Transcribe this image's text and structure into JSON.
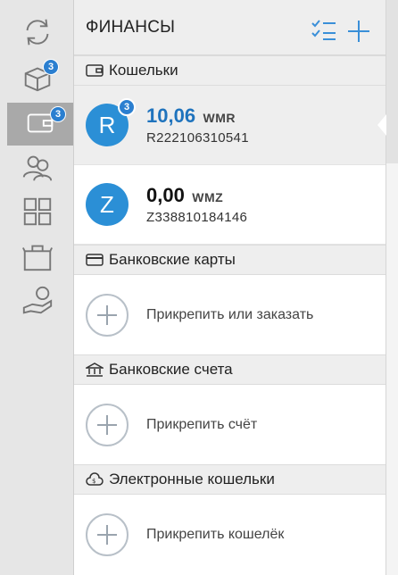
{
  "header": {
    "title": "ФИНАНСЫ",
    "filter_icon": "checklist-filter-icon",
    "add_icon": "plus-icon"
  },
  "rail": {
    "items": [
      {
        "name": "sync-icon",
        "badge": ""
      },
      {
        "name": "boxes-icon",
        "badge": "3"
      },
      {
        "name": "wallet-icon",
        "badge": "3"
      },
      {
        "name": "contacts-icon",
        "badge": ""
      },
      {
        "name": "services-grid-icon",
        "badge": ""
      },
      {
        "name": "shop-bag-icon",
        "badge": ""
      },
      {
        "name": "hand-money-icon",
        "badge": ""
      }
    ]
  },
  "sections": {
    "wallets": {
      "title": "Кошельки",
      "items": [
        {
          "letter": "R",
          "amount": "10,06",
          "currency": "WMR",
          "id": "R222106310541",
          "badge": "3"
        },
        {
          "letter": "Z",
          "amount": "0,00",
          "currency": "WMZ",
          "id": "Z338810184146",
          "badge": ""
        }
      ]
    },
    "bank_cards": {
      "title": "Банковские карты",
      "action": "Прикрепить или заказать"
    },
    "bank_accounts": {
      "title": "Банковские счета",
      "action": "Прикрепить счёт"
    },
    "e_wallets": {
      "title": "Электронные кошельки",
      "action": "Прикрепить кошелёк"
    }
  },
  "colors": {
    "accent": "#1f73bd",
    "avatar": "#2b8fd6",
    "badge": "#2b7fd0"
  }
}
